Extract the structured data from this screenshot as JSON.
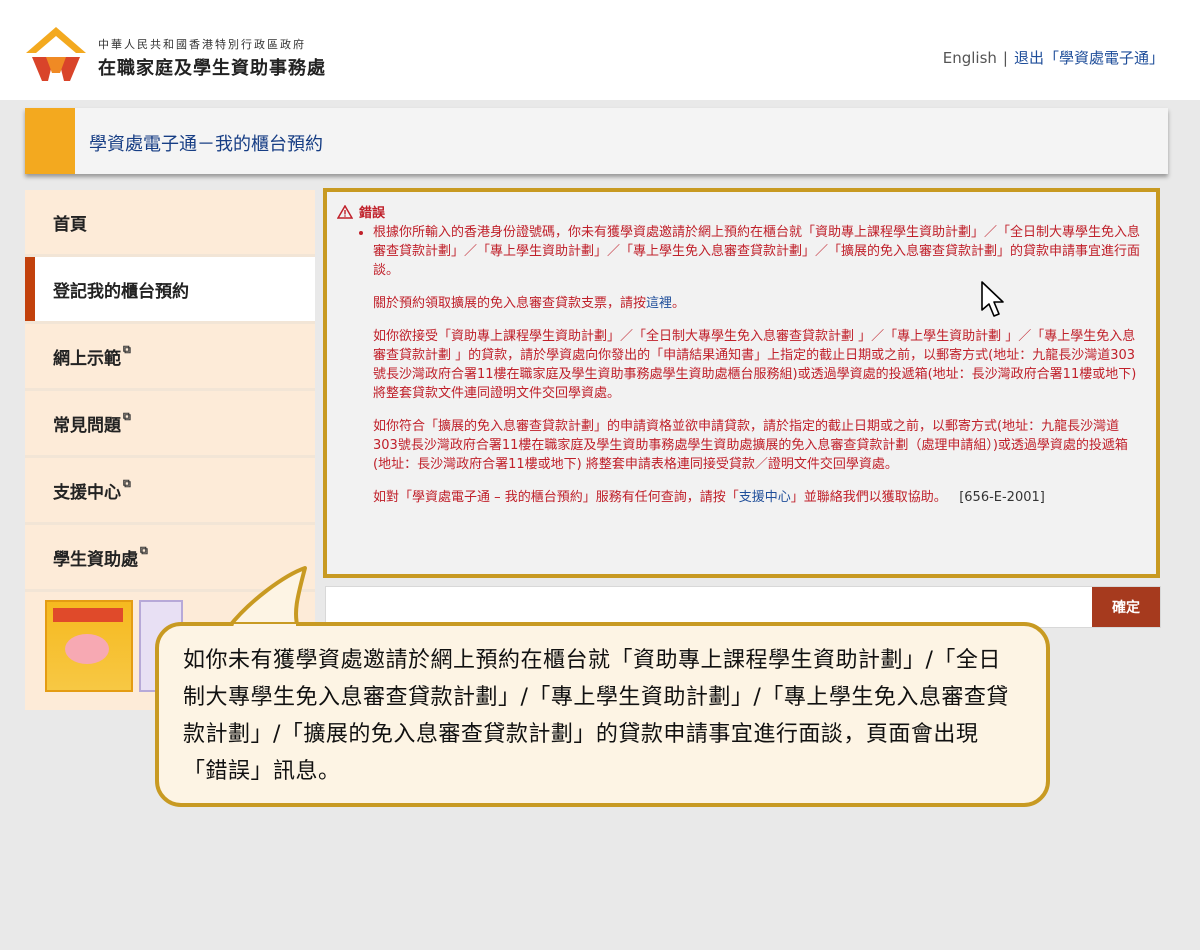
{
  "header": {
    "agency_line1": "中華人民共和國香港特別行政區政府",
    "agency_line2": "在職家庭及學生資助事務處",
    "lang_link": "English",
    "separator": "|",
    "logout_link": "退出「學資處電子通」",
    "logo_icon": "sfo-logo-icon"
  },
  "page": {
    "title": "學資處電子通－我的櫃台預約"
  },
  "sidebar": {
    "items": [
      {
        "label": "首頁",
        "external": false
      },
      {
        "label": "登記我的櫃台預約",
        "external": false,
        "active": true
      },
      {
        "label": "網上示範",
        "external": true
      },
      {
        "label": "常見問題",
        "external": true
      },
      {
        "label": "支援中心",
        "external": true
      },
      {
        "label": "學生資助處",
        "external": true
      }
    ]
  },
  "error": {
    "heading": "錯誤",
    "p1": "根據你所輸入的香港身份證號碼，你未有獲學資處邀請於網上預約在櫃台就「資助專上課程學生資助計劃」／「全日制大專學生免入息審查貸款計劃」／「專上學生資助計劃」／「專上學生免入息審查貸款計劃」／「擴展的免入息審查貸款計劃」的貸款申請事宜進行面談。",
    "p2_before": "關於預約領取擴展的免入息審查貸款支票，請按",
    "p2_link": "這裡",
    "p2_after": "。",
    "p3": "如你欲接受「資助專上課程學生資助計劃」／「全日制大專學生免入息審查貸款計劃 」／「專上學生資助計劃 」／「專上學生免入息審查貸款計劃 」的貸款，請於學資處向你發出的「申請結果通知書」上指定的截止日期或之前，以郵寄方式(地址：九龍長沙灣道303號長沙灣政府合署11樓在職家庭及學生資助事務處學生資助處櫃台服務組)或透過學資處的投遞箱(地址：長沙灣政府合署11樓或地下) 將整套貸款文件連同證明文件交回學資處。",
    "p4": "如你符合「擴展的免入息審查貸款計劃」的申請資格並欲申請貸款，請於指定的截止日期或之前，以郵寄方式(地址：九龍長沙灣道303號長沙灣政府合署11樓在職家庭及學生資助事務處學生資助處擴展的免入息審查貸款計劃（處理申請組）)或透過學資處的投遞箱(地址：長沙灣政府合署11樓或地下) 將整套申請表格連同接受貸款／證明文件交回學資處。",
    "p5_before": "如對「學資處電子通 – 我的櫃台預約」服務有任何查詢，請按「",
    "p5_link": "支援中心",
    "p5_after": "」並聯絡我們以獲取協助。",
    "code": "[656-E-2001]"
  },
  "confirm": {
    "button_label": "確定"
  },
  "callout": {
    "text": "如你未有獲學資處邀請於網上預約在櫃台就「資助專上課程學生資助計劃」/「全日制大專學生免入息審查貸款計劃」/「專上學生資助計劃」/「專上學生免入息審查貸款計劃」/「擴展的免入息審查貸款計劃」的貸款申請事宜進行面談，頁面會出現「錯誤」訊息。"
  },
  "colors": {
    "accent_orange": "#f3a91f",
    "active_bar": "#c2410c",
    "error_red": "#c0202a",
    "gold_border": "#c89a22",
    "title_blue": "#163d84",
    "button_brown": "#a63a1e"
  }
}
